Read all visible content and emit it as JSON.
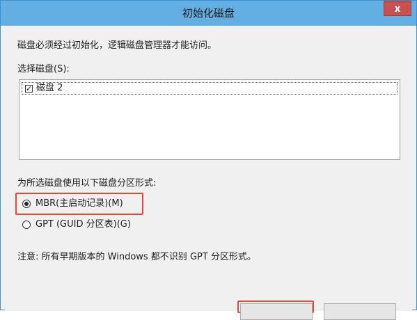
{
  "window": {
    "title": "初始化磁盘",
    "close_label": "x"
  },
  "intro_text": "磁盘必须经过初始化，逻辑磁盘管理器才能访问。",
  "select_label": "选择磁盘(S):",
  "disks": [
    {
      "label": "磁盘 2",
      "checked": true
    }
  ],
  "partition_label": "为所选磁盘使用以下磁盘分区形式:",
  "partition_options": [
    {
      "label": "MBR(主启动记录)(M)",
      "selected": true
    },
    {
      "label": "GPT (GUID 分区表)(G)",
      "selected": false
    }
  ],
  "note": "注意: 所有早期版本的 Windows 都不识别 GPT 分区形式。",
  "colors": {
    "titlebar": "#63aee3",
    "highlight": "#e5493a",
    "close": "#c75050"
  }
}
